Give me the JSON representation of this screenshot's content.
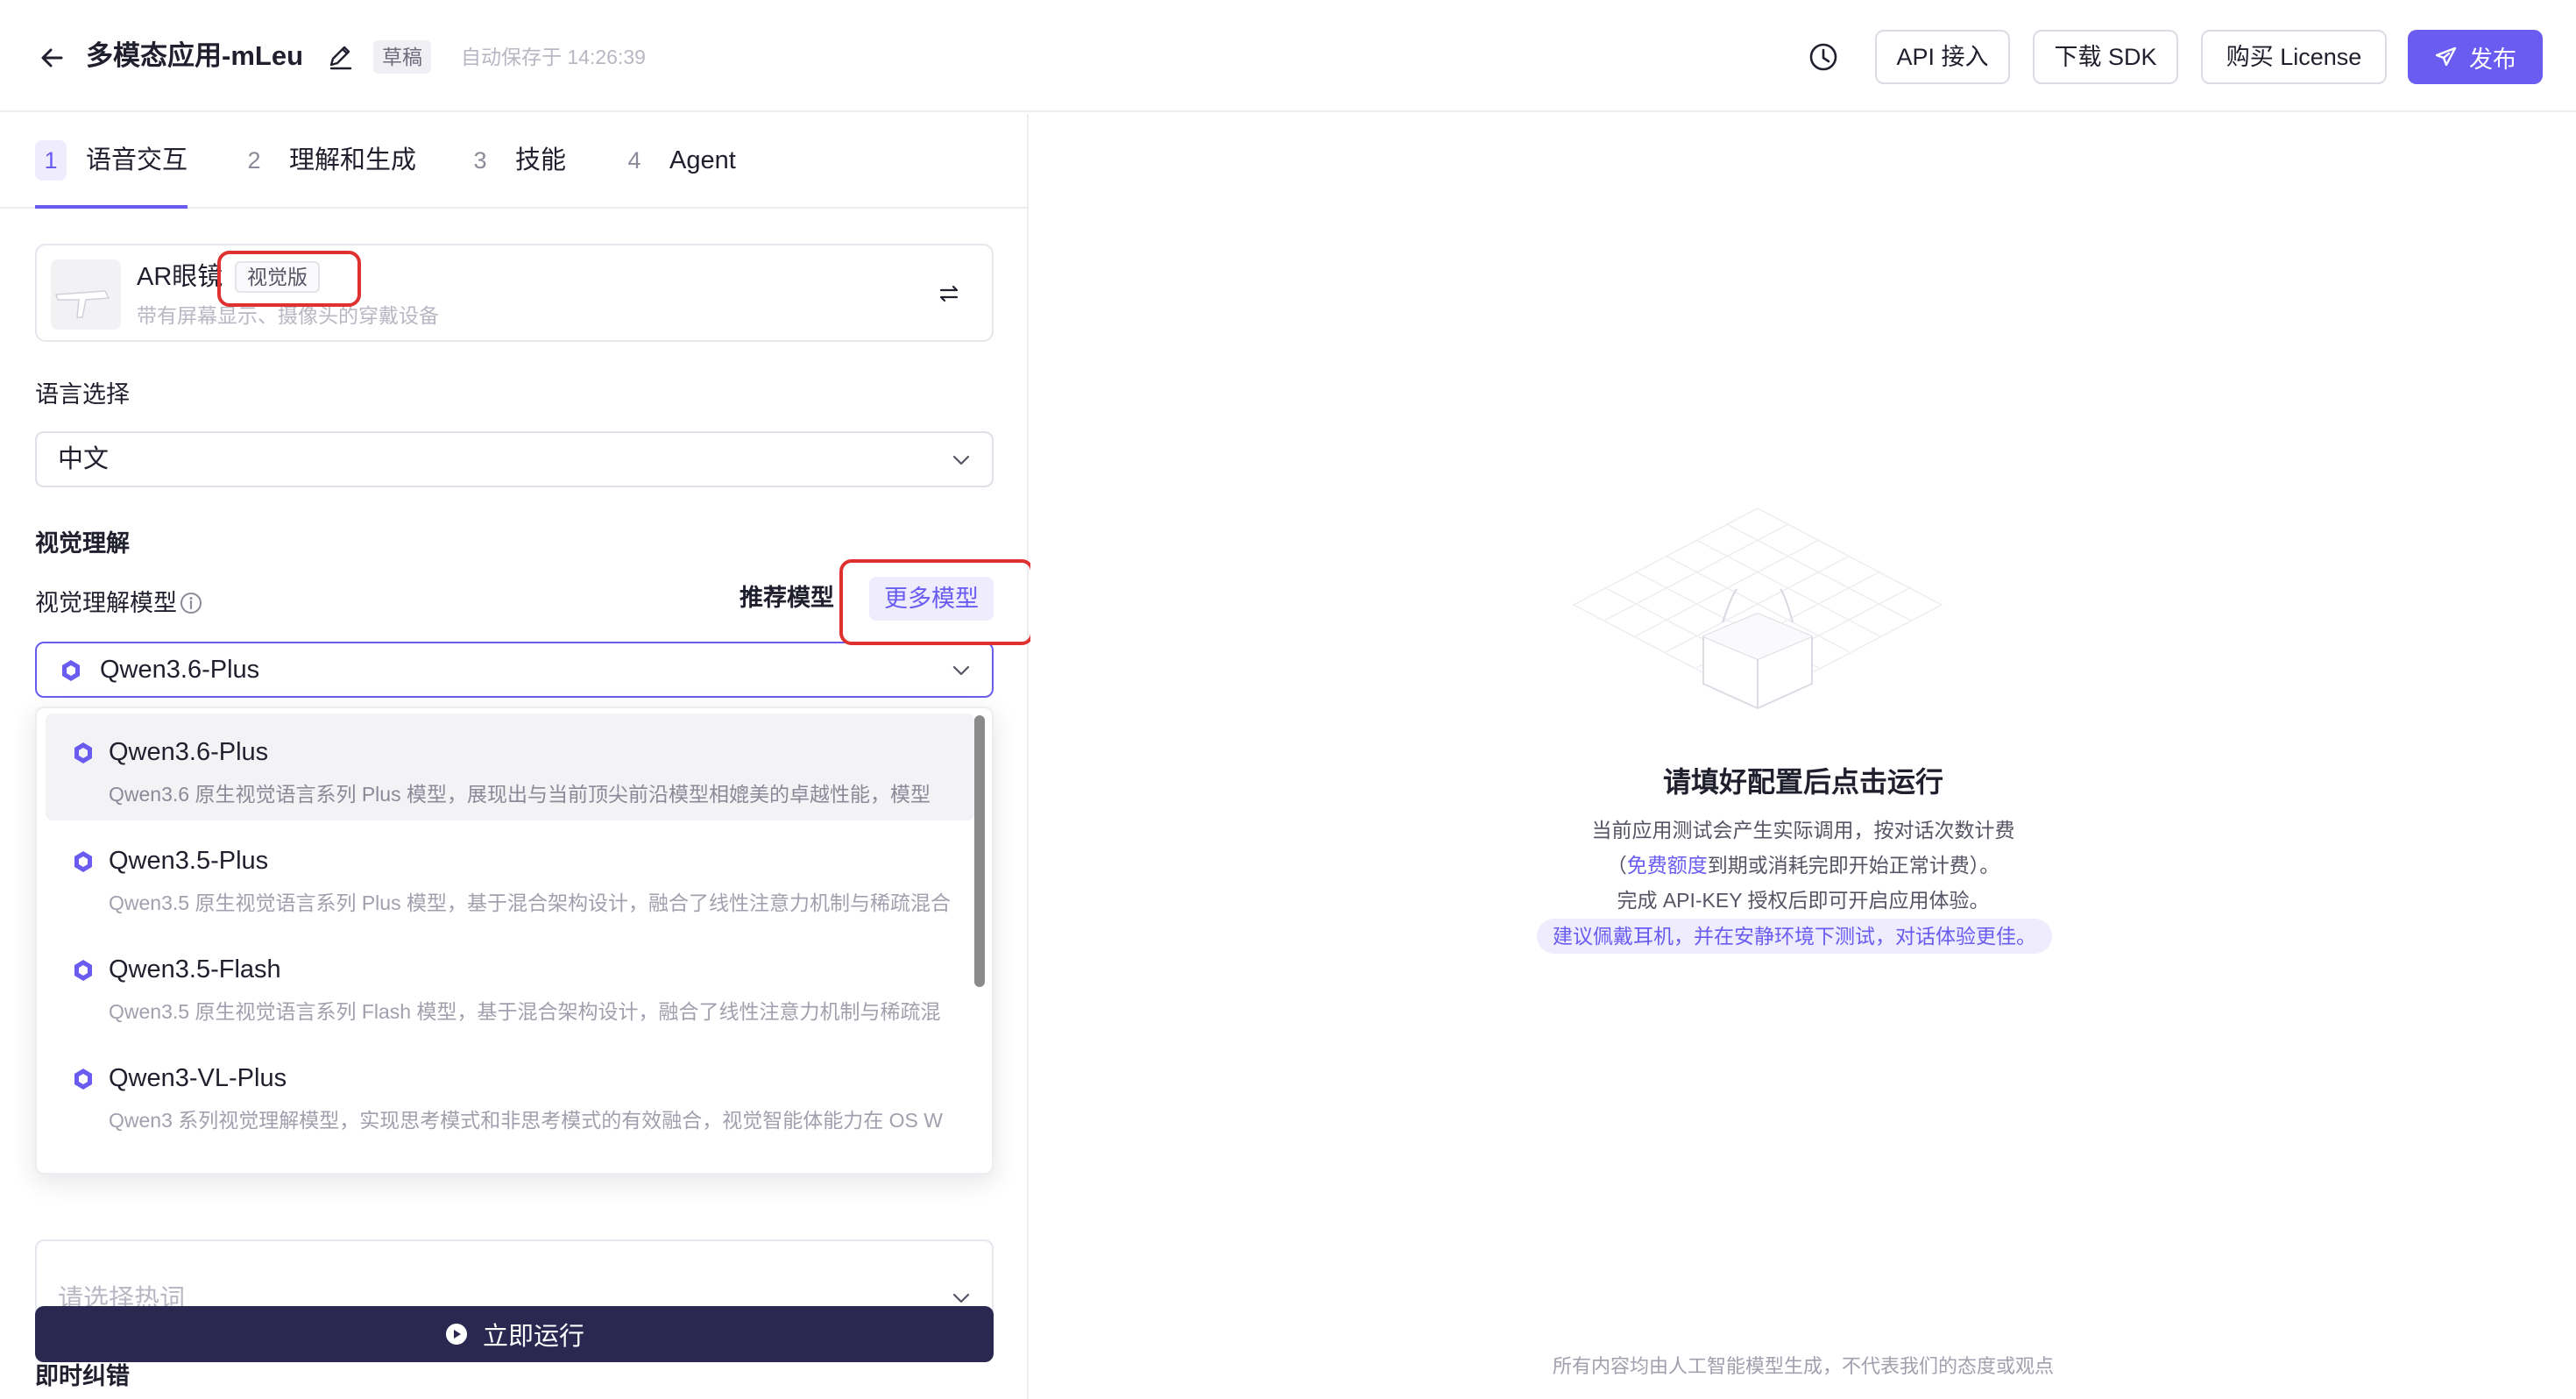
{
  "header": {
    "title": "多模态应用-mLeu",
    "draft_badge": "草稿",
    "autosave": "自动保存于 14:26:39",
    "api_button": "API 接入",
    "sdk_button": "下载 SDK",
    "license_button": "购买 License",
    "publish_button": "发布"
  },
  "tabs": [
    {
      "num": "1",
      "label": "语音交互"
    },
    {
      "num": "2",
      "label": "理解和生成"
    },
    {
      "num": "3",
      "label": "技能"
    },
    {
      "num": "4",
      "label": "Agent"
    }
  ],
  "device": {
    "name": "AR眼镜",
    "badge": "视觉版",
    "description": "带有屏幕显示、摄像头的穿戴设备"
  },
  "language": {
    "label": "语言选择",
    "value": "中文"
  },
  "vision": {
    "section_label": "视觉理解",
    "model_label": "视觉理解模型",
    "recommended_label": "推荐模型",
    "more_models": "更多模型",
    "selected_model": "Qwen3.6-Plus"
  },
  "model_options": [
    {
      "name": "Qwen3.6-Plus",
      "description": "Qwen3.6 原生视觉语言系列 Plus 模型，展现出与当前顶尖前沿模型相媲美的卓越性能，模型"
    },
    {
      "name": "Qwen3.5-Plus",
      "description": "Qwen3.5 原生视觉语言系列 Plus 模型，基于混合架构设计，融合了线性注意力机制与稀疏混合"
    },
    {
      "name": "Qwen3.5-Flash",
      "description": "Qwen3.5 原生视觉语言系列 Flash 模型，基于混合架构设计，融合了线性注意力机制与稀疏混"
    },
    {
      "name": "Qwen3-VL-Plus",
      "description": "Qwen3 系列视觉理解模型，实现思考模式和非思考模式的有效融合，视觉智能体能力在 OS W"
    }
  ],
  "hotword": {
    "placeholder": "请选择热词"
  },
  "correction": {
    "label": "即时纠错"
  },
  "run_button": "立即运行",
  "empty_state": {
    "title": "请填好配置后点击运行",
    "line1": "当前应用测试会产生实际调用，按对话次数计费",
    "line2_prefix": "（",
    "line2_link": "免费额度",
    "line2_suffix": "到期或消耗完即开始正常计费）。",
    "line3": "完成 API-KEY 授权后即可开启应用体验。",
    "tip": "建议佩戴耳机，并在安静环境下测试，对话体验更佳。"
  },
  "footer_note": "所有内容均由人工智能模型生成，不代表我们的态度或观点",
  "colors": {
    "accent": "#6a5cf0",
    "run_button": "#2a2750",
    "highlight_box": "#e03131"
  }
}
